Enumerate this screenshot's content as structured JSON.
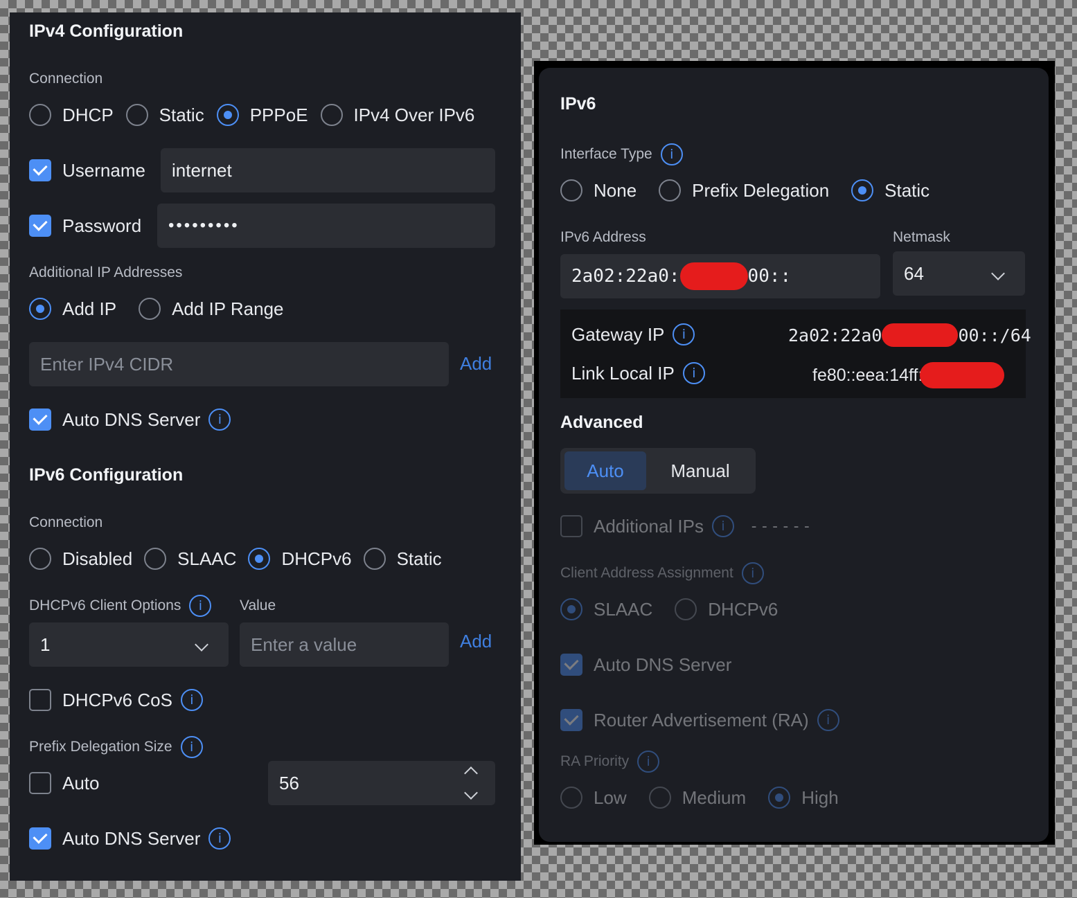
{
  "ipv4": {
    "title": "IPv4 Configuration",
    "connection_label": "Connection",
    "connection_options": [
      "DHCP",
      "Static",
      "PPPoE",
      "IPv4 Over IPv6"
    ],
    "connection_selected": "PPPoE",
    "username_label": "Username",
    "username_value": "internet",
    "password_label": "Password",
    "password_value": "•••••••••",
    "additional_ip_label": "Additional IP Addresses",
    "add_ip_options": [
      "Add IP",
      "Add IP Range"
    ],
    "add_ip_selected": "Add IP",
    "cidr_placeholder": "Enter IPv4 CIDR",
    "add_label": "Add",
    "auto_dns_label": "Auto DNS Server"
  },
  "ipv6_config": {
    "title": "IPv6 Configuration",
    "connection_label": "Connection",
    "connection_options": [
      "Disabled",
      "SLAAC",
      "DHCPv6",
      "Static"
    ],
    "connection_selected": "DHCPv6",
    "client_options_label": "DHCPv6 Client Options",
    "value_label": "Value",
    "client_option_value": "1",
    "value_placeholder": "Enter a value",
    "add_label": "Add",
    "cos_label": "DHCPv6 CoS",
    "prefix_size_label": "Prefix Delegation Size",
    "auto_label": "Auto",
    "prefix_size_value": "56",
    "auto_dns_label": "Auto DNS Server"
  },
  "ipv6_panel": {
    "title": "IPv6",
    "interface_type_label": "Interface Type",
    "interface_options": [
      "None",
      "Prefix Delegation",
      "Static"
    ],
    "interface_selected": "Static",
    "address_label": "IPv6 Address",
    "address_prefix": "2a02:22a0:",
    "address_suffix": "00::",
    "netmask_label": "Netmask",
    "netmask_value": "64",
    "gateway_label": "Gateway IP",
    "gateway_prefix": "2a02:22a0",
    "gateway_suffix": "00::/64",
    "link_local_label": "Link Local IP",
    "link_local_prefix": "fe80::eea:14ff:",
    "advanced_title": "Advanced",
    "mode_tabs": [
      "Auto",
      "Manual"
    ],
    "mode_selected": "Auto",
    "additional_ips_label": "Additional IPs",
    "additional_ips_value": "------",
    "client_assignment_label": "Client Address Assignment",
    "assignment_options": [
      "SLAAC",
      "DHCPv6"
    ],
    "assignment_selected": "SLAAC",
    "auto_dns_label": "Auto DNS Server",
    "ra_label": "Router Advertisement (RA)",
    "ra_priority_label": "RA Priority",
    "priority_options": [
      "Low",
      "Medium",
      "High"
    ],
    "priority_selected": "High"
  },
  "colors": {
    "accent": "#4d8ff5",
    "panel_bg": "#1c1e24",
    "input_bg": "#2b2d33",
    "redaction": "#e51c1c"
  }
}
